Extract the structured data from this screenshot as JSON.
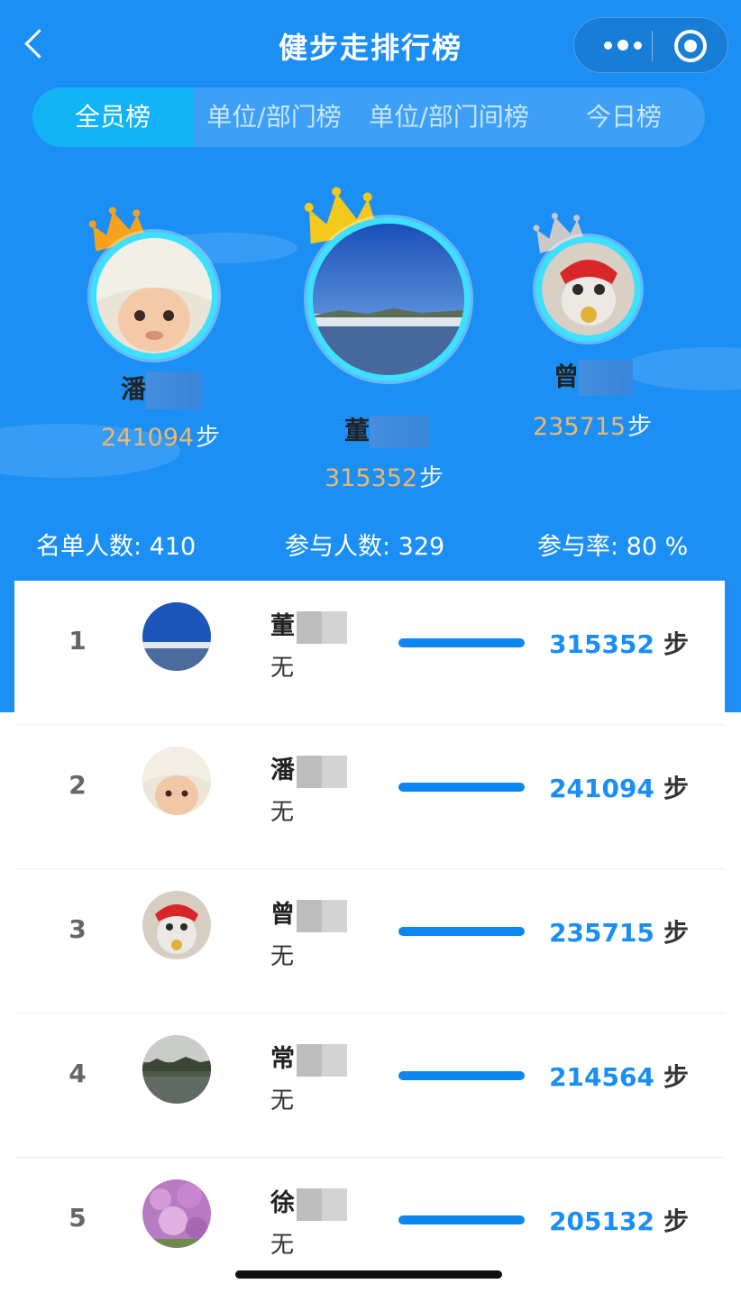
{
  "header": {
    "title": "健步走排行榜"
  },
  "tabs": [
    {
      "label": "全员榜",
      "active": true
    },
    {
      "label": "单位/部门榜",
      "active": false
    },
    {
      "label": "单位/部门间榜",
      "active": false
    },
    {
      "label": "今日榜",
      "active": false
    }
  ],
  "podium": {
    "first": {
      "name": "董",
      "steps": "315352",
      "unit": "步"
    },
    "second": {
      "name": "潘",
      "steps": "241094",
      "unit": "步"
    },
    "third": {
      "name": "曾",
      "steps": "235715",
      "unit": "步"
    }
  },
  "stats": {
    "roster": "名单人数: 410",
    "participants": "参与人数: 329",
    "rate": "参与率: 80 %"
  },
  "rows": [
    {
      "rank": "1",
      "name": "董",
      "dept": "无",
      "steps": "315352",
      "unit": "步"
    },
    {
      "rank": "2",
      "name": "潘",
      "dept": "无",
      "steps": "241094",
      "unit": "步"
    },
    {
      "rank": "3",
      "name": "曾",
      "dept": "无",
      "steps": "235715",
      "unit": "步"
    },
    {
      "rank": "4",
      "name": "常",
      "dept": "无",
      "steps": "214564",
      "unit": "步"
    },
    {
      "rank": "5",
      "name": "徐",
      "dept": "无",
      "steps": "205132",
      "unit": "步"
    }
  ],
  "colors": {
    "brand": "#1c8ff4",
    "steps_blue": "#1a8ef3",
    "gold_steps": "#f0b66a",
    "ring": "#3ee0ff"
  }
}
